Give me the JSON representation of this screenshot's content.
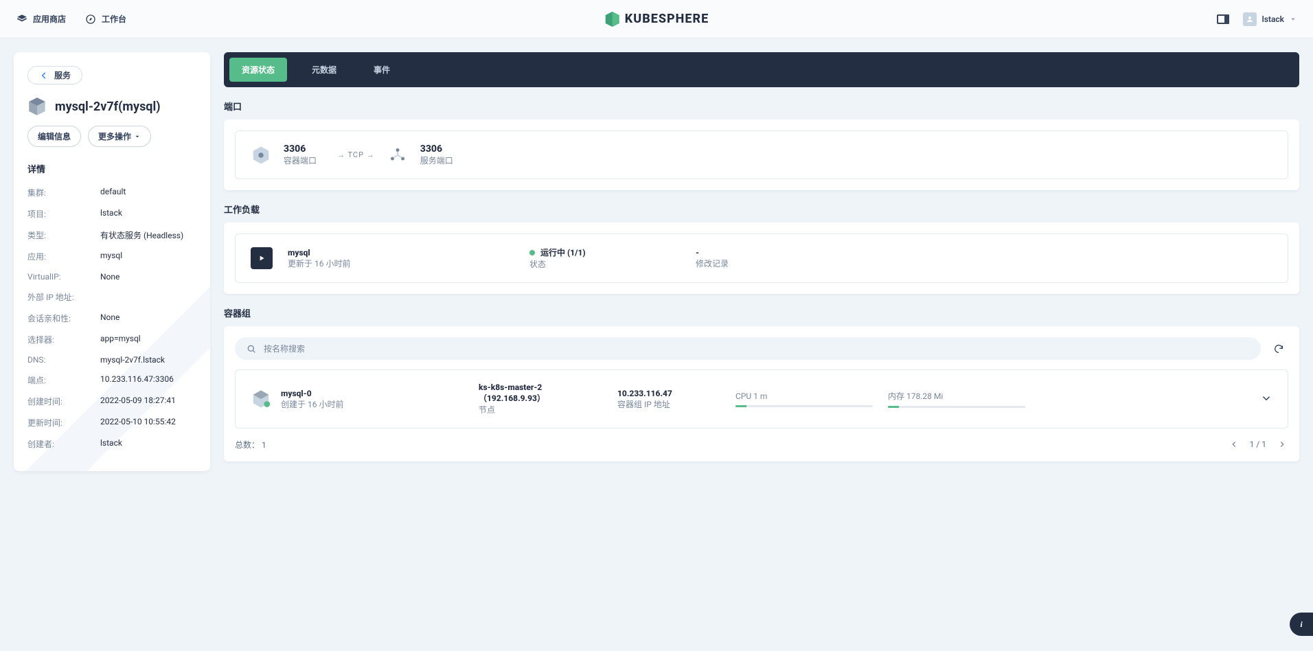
{
  "topbar": {
    "app_store": "应用商店",
    "workbench": "工作台",
    "brand": "KUBESPHERE",
    "user": "lstack"
  },
  "side": {
    "back_label": "服务",
    "title": "mysql-2v7f(mysql)",
    "edit_btn": "编辑信息",
    "more_btn": "更多操作",
    "details_heading": "详情",
    "items": [
      {
        "k": "集群:",
        "v": "default"
      },
      {
        "k": "项目:",
        "v": "lstack"
      },
      {
        "k": "类型:",
        "v": "有状态服务 (Headless)"
      },
      {
        "k": "应用:",
        "v": "mysql"
      },
      {
        "k": "VirtualIP:",
        "v": "None"
      },
      {
        "k": "外部 IP 地址:",
        "v": ""
      },
      {
        "k": "会话亲和性:",
        "v": "None"
      },
      {
        "k": "选择器:",
        "v": "app=mysql"
      },
      {
        "k": "DNS:",
        "v": "mysql-2v7f.lstack"
      },
      {
        "k": "端点:",
        "v": "10.233.116.47:3306"
      },
      {
        "k": "创建时间:",
        "v": "2022-05-09 18:27:41"
      },
      {
        "k": "更新时间:",
        "v": "2022-05-10 10:55:42"
      },
      {
        "k": "创建者:",
        "v": "lstack"
      }
    ]
  },
  "tabs": {
    "resource": "资源状态",
    "metadata": "元数据",
    "events": "事件"
  },
  "ports": {
    "heading": "端口",
    "container_port": "3306",
    "container_port_label": "容器端口",
    "protocol": "TCP",
    "service_port": "3306",
    "service_port_label": "服务端口"
  },
  "workloads": {
    "heading": "工作负载",
    "name": "mysql",
    "updated": "更新于 16 小时前",
    "status_text": "运行中 (1/1)",
    "status_label": "状态",
    "record_value": "-",
    "record_label": "修改记录"
  },
  "pods": {
    "heading": "容器组",
    "search_placeholder": "按名称搜索",
    "name": "mysql-0",
    "created": "创建于 16 小时前",
    "node_top": "ks-k8s-master-2（192.168.9.93）",
    "node_bot": "节点",
    "ip_top": "10.233.116.47",
    "ip_bot": "容器组 IP 地址",
    "cpu": "CPU 1 m",
    "mem": "内存 178.28 Mi",
    "total_label": "总数：",
    "total_value": "1",
    "page": "1 / 1"
  }
}
